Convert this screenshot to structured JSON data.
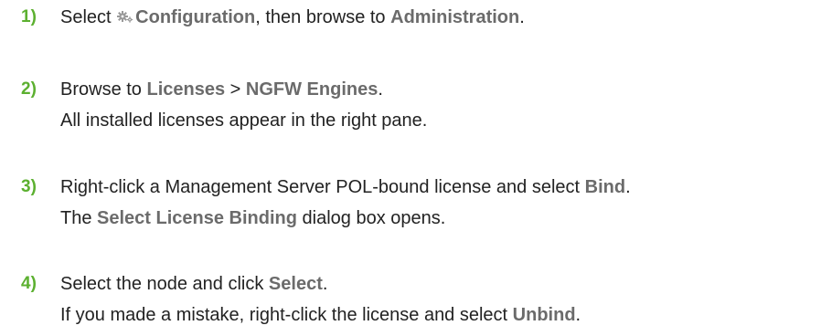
{
  "steps": [
    {
      "number": "1)",
      "line1": {
        "pre": "Select ",
        "ui1": "Configuration",
        "mid": ", then browse to ",
        "ui2": "Administration",
        "post": "."
      },
      "icon": "configuration-gear-icon"
    },
    {
      "number": "2)",
      "line1": {
        "pre": "Browse to ",
        "ui1": "Licenses",
        "mid": " > ",
        "ui2": "NGFW Engines",
        "post": "."
      },
      "line2": "All installed licenses appear in the right pane."
    },
    {
      "number": "3)",
      "line1": {
        "pre": "Right-click a Management Server POL-bound license and select ",
        "ui1": "Bind",
        "post": "."
      },
      "line2": {
        "pre": "The ",
        "ui1": "Select License Binding",
        "post": " dialog box opens."
      }
    },
    {
      "number": "4)",
      "line1": {
        "pre": "Select the node and click ",
        "ui1": "Select",
        "post": "."
      },
      "line2": {
        "pre": "If you made a mistake, right-click the license and select ",
        "ui1": "Unbind",
        "post": "."
      }
    }
  ],
  "colors": {
    "step_number": "#5cb030",
    "ui_term": "#6b6b6b",
    "body_text": "#222222"
  }
}
